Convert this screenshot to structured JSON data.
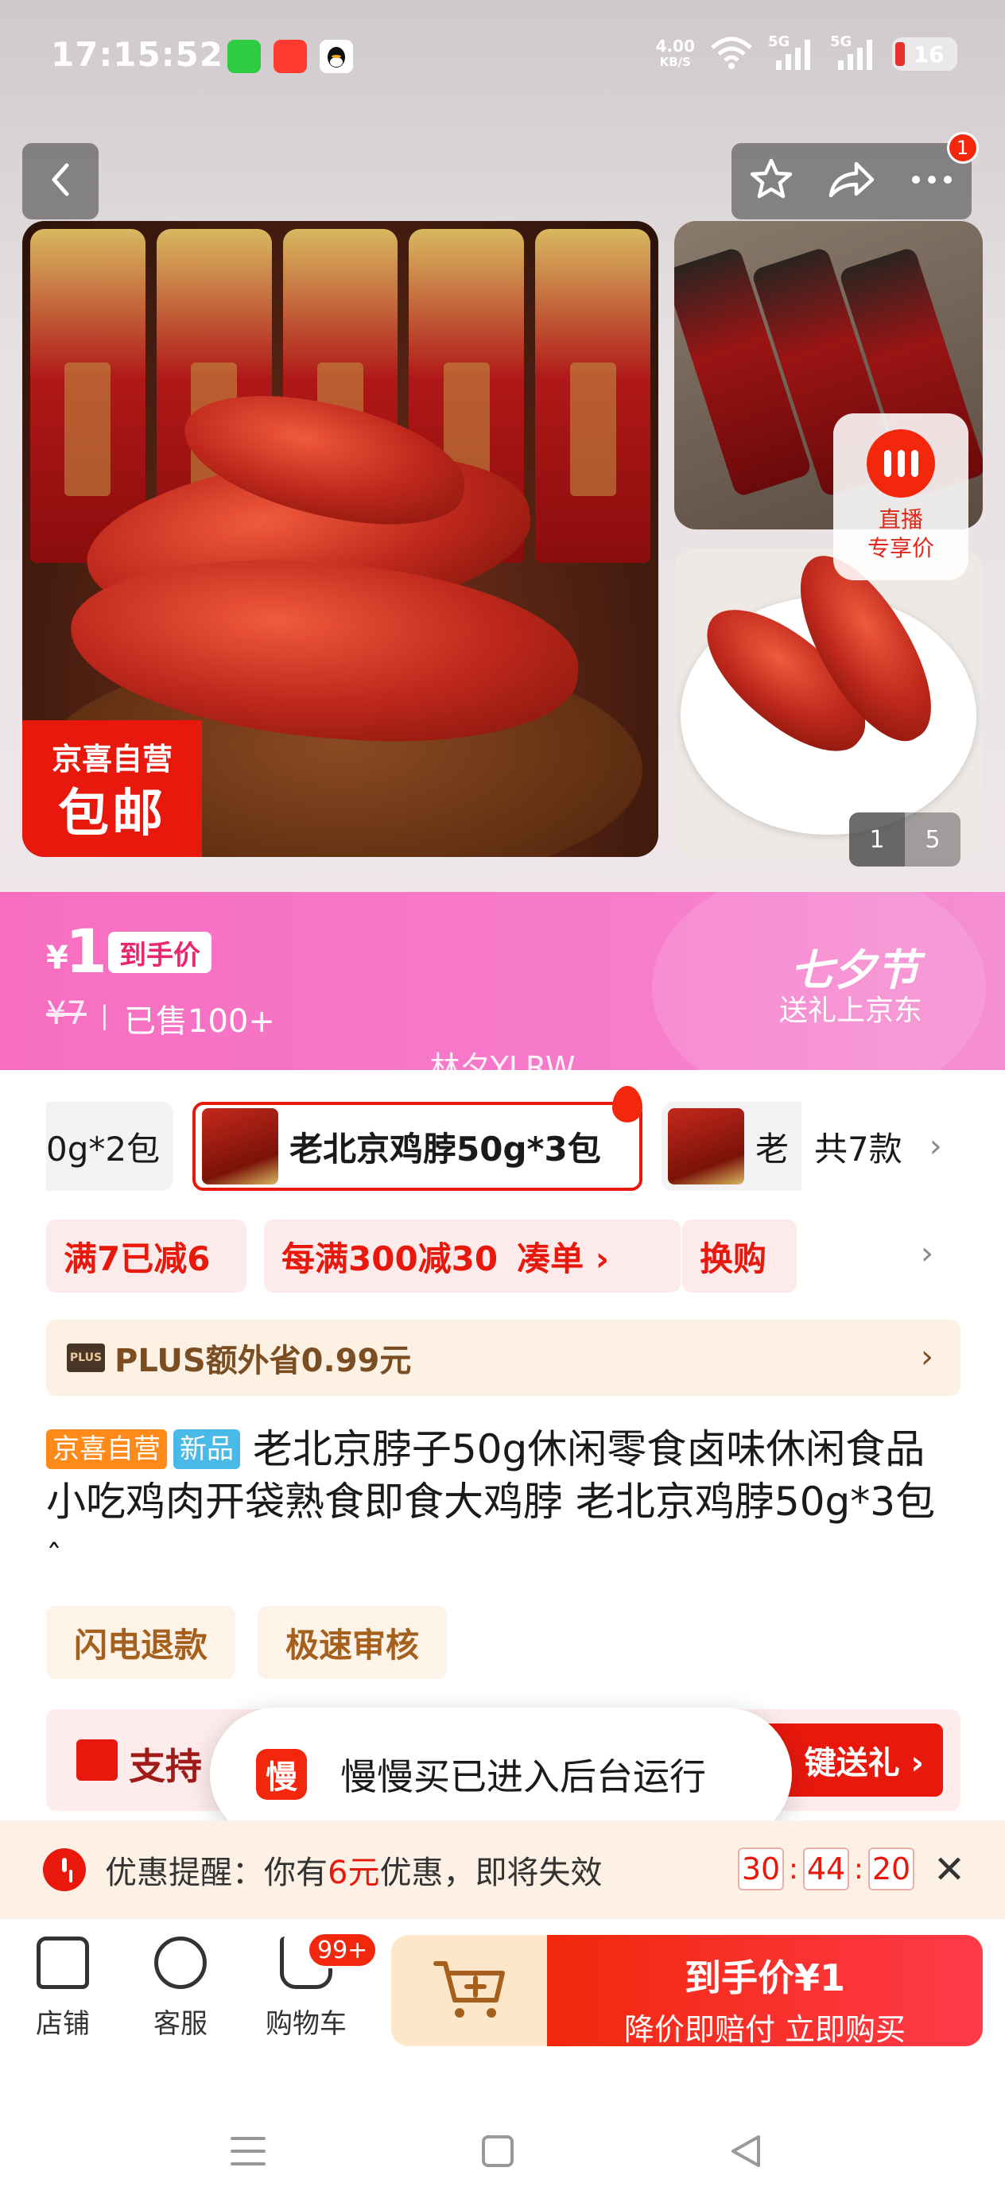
{
  "status_bar": {
    "time": "17:15:52",
    "net_speed_value": "4.00",
    "net_speed_unit": "KB/S",
    "signal_1": "5G",
    "signal_2": "5G",
    "battery": "16"
  },
  "header": {
    "cart_badge_count": "1"
  },
  "gallery": {
    "badge_line1": "京喜自营",
    "badge_line2": "包邮",
    "live_label": "直播\n专享价",
    "live_line1": "直播",
    "live_line2": "专享价",
    "page_current": "1",
    "page_total": "5"
  },
  "price_banner": {
    "currency": "¥",
    "price": "1",
    "price_tag": "到手价",
    "original_price": "¥7",
    "separator": "|",
    "sold": "已售100+",
    "festival_title": "七夕节",
    "festival_subtitle": "送礼上京东",
    "watermark": "林夕YLRW"
  },
  "variants": {
    "items": [
      {
        "label": "0g*2包"
      },
      {
        "label": "老北京鸡脖50g*3包"
      },
      {
        "label": "老"
      }
    ],
    "total_label": "共7款",
    "total_chevron": "›"
  },
  "promotions": {
    "items": [
      {
        "label": "满7已减6"
      },
      {
        "label": "每满300减30"
      },
      {
        "label": "凑单 ›"
      },
      {
        "label": "换购"
      }
    ],
    "chevron": "›",
    "plus_logo": "PLUS",
    "plus_text": "PLUS额外省0.99元",
    "plus_chevron": "›"
  },
  "product": {
    "tag_self": "京喜自营",
    "tag_new": "新品",
    "title": "老北京脖子50g休闲零食卤味休闲食品小吃鸡肉开袋熟食即食大鸡脖 老北京鸡脖50g*3包",
    "collapse": "ˆ",
    "services": [
      "闪电退款",
      "极速审核"
    ]
  },
  "gift": {
    "text": "支持",
    "button": "键送礼 ›"
  },
  "toast": {
    "icon_char": "慢",
    "text": "慢慢买已进入后台运行"
  },
  "reminder": {
    "prefix": "优惠提醒：你有",
    "amount": "6元",
    "suffix": "优惠，即将失效",
    "hours": "30",
    "minutes": "44",
    "seconds": "20",
    "colon": ":",
    "close": "✕"
  },
  "bottom_bar": {
    "shop": "店铺",
    "service": "客服",
    "cart": "购物车",
    "cart_badge": "99+",
    "buy_line1": "到手价¥1",
    "buy_line2": "降价即赔付 立即购买"
  },
  "colors": {
    "brand_red": "#e8180c",
    "banner_pink": "#f77bcb",
    "plus_brown": "#7a4e22"
  }
}
